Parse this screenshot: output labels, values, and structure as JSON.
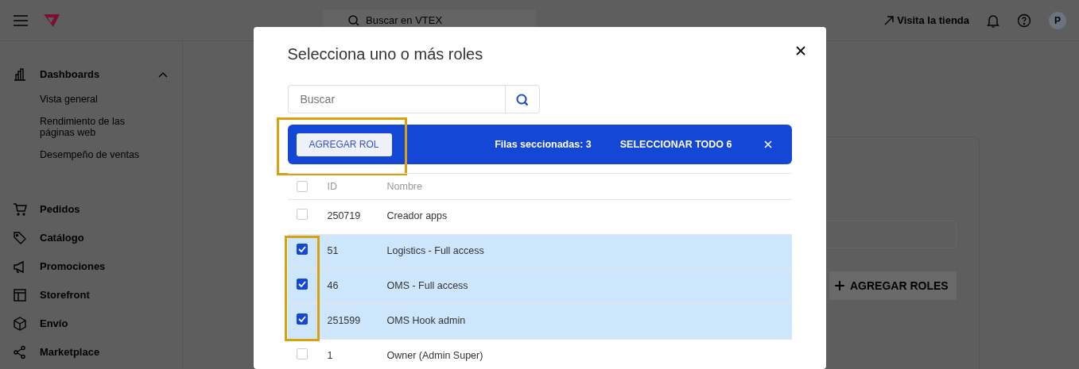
{
  "topbar": {
    "search_placeholder": "Buscar en VTEX",
    "store_link": "Visita la tienda",
    "avatar": "P"
  },
  "sidebar": {
    "items": [
      {
        "label": "Dashboards",
        "expanded": true,
        "children": [
          {
            "label": "Vista general"
          },
          {
            "label": "Rendimiento de las páginas web"
          },
          {
            "label": "Desempeño de ventas"
          }
        ]
      },
      {
        "label": "Pedidos"
      },
      {
        "label": "Catálogo"
      },
      {
        "label": "Promociones"
      },
      {
        "label": "Storefront"
      },
      {
        "label": "Envío"
      },
      {
        "label": "Marketplace"
      }
    ]
  },
  "background_card": {
    "button": "AGREGAR ROLES"
  },
  "modal": {
    "title": "Selecciona uno o más roles",
    "search": {
      "placeholder": "Buscar"
    },
    "bulk_bar": {
      "button": "AGREGAR ROL",
      "highlighted": true,
      "selected_count": "Filas seccionadas: 3",
      "select_all": "SELECCIONAR TODO 6"
    },
    "table": {
      "header_checked": false,
      "columns": [
        "ID",
        "Nombre"
      ],
      "checked_highlighted": true,
      "rows": [
        {
          "id": "250719",
          "name": "Creador apps",
          "checked": false
        },
        {
          "id": "51",
          "name": "Logistics - Full access",
          "checked": true
        },
        {
          "id": "46",
          "name": "OMS - Full access",
          "checked": true
        },
        {
          "id": "251599",
          "name": "OMS Hook admin",
          "checked": true
        },
        {
          "id": "1",
          "name": "Owner (Admin Super)",
          "checked": false
        }
      ]
    }
  }
}
